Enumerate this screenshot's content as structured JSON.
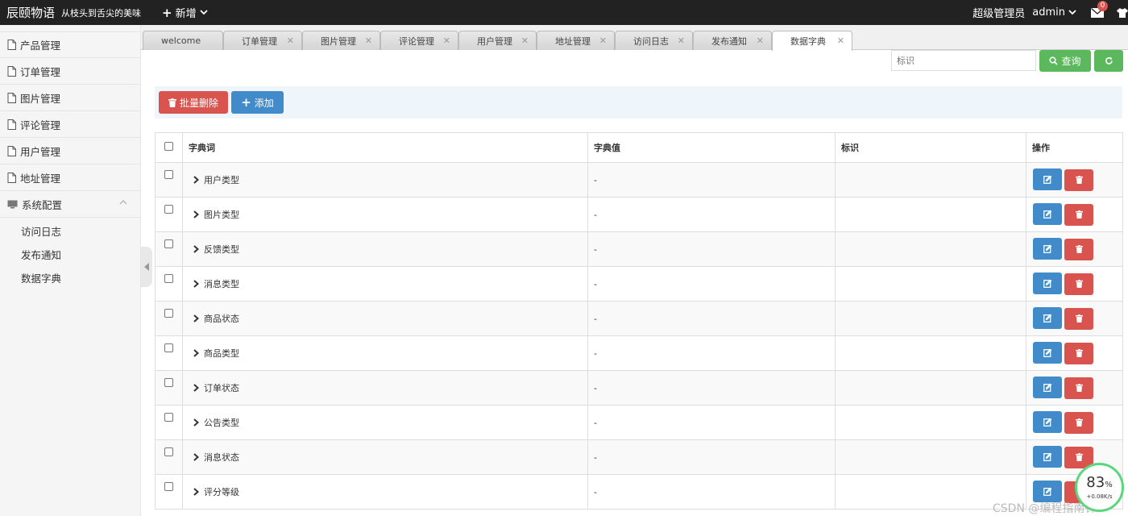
{
  "header": {
    "brand": "辰颐物语",
    "slogan": "从枝头到舌尖的美味",
    "new_label": "新增",
    "user_role": "超级管理员",
    "user_name": "admin",
    "mail_badge": "0"
  },
  "sidebar": {
    "items": [
      {
        "label": "产品管理"
      },
      {
        "label": "订单管理"
      },
      {
        "label": "图片管理"
      },
      {
        "label": "评论管理"
      },
      {
        "label": "用户管理"
      },
      {
        "label": "地址管理"
      },
      {
        "label": "系统配置"
      }
    ],
    "sub_items": [
      {
        "label": "访问日志"
      },
      {
        "label": "发布通知"
      },
      {
        "label": "数据字典"
      }
    ]
  },
  "tabs": [
    {
      "label": "welcome"
    },
    {
      "label": "订单管理"
    },
    {
      "label": "图片管理"
    },
    {
      "label": "评论管理"
    },
    {
      "label": "用户管理"
    },
    {
      "label": "地址管理"
    },
    {
      "label": "访问日志"
    },
    {
      "label": "发布通知"
    },
    {
      "label": "数据字典"
    }
  ],
  "search": {
    "placeholder": "标识",
    "query_label": "查询"
  },
  "toolbar": {
    "batch_delete_label": "批量删除",
    "add_label": "添加"
  },
  "table": {
    "headers": {
      "word": "字典词",
      "value": "字典值",
      "ident": "标识",
      "ops": "操作"
    },
    "rows": [
      {
        "word": "用户类型",
        "value": "-",
        "ident": ""
      },
      {
        "word": "图片类型",
        "value": "-",
        "ident": ""
      },
      {
        "word": "反馈类型",
        "value": "-",
        "ident": ""
      },
      {
        "word": "消息类型",
        "value": "-",
        "ident": ""
      },
      {
        "word": "商品状态",
        "value": "-",
        "ident": ""
      },
      {
        "word": "商品类型",
        "value": "-",
        "ident": ""
      },
      {
        "word": "订单状态",
        "value": "-",
        "ident": ""
      },
      {
        "word": "公告类型",
        "value": "-",
        "ident": ""
      },
      {
        "word": "消息状态",
        "value": "-",
        "ident": ""
      },
      {
        "word": "评分等级",
        "value": "-",
        "ident": ""
      }
    ]
  },
  "watermark": "CSDN @编程指南针",
  "net_widget": {
    "percent": "83",
    "percent_unit": "%",
    "rate": "+0.08K/s"
  },
  "colors": {
    "header_bg": "#222222",
    "green": "#5cb85c",
    "red": "#d9534f",
    "blue": "#428bca"
  }
}
